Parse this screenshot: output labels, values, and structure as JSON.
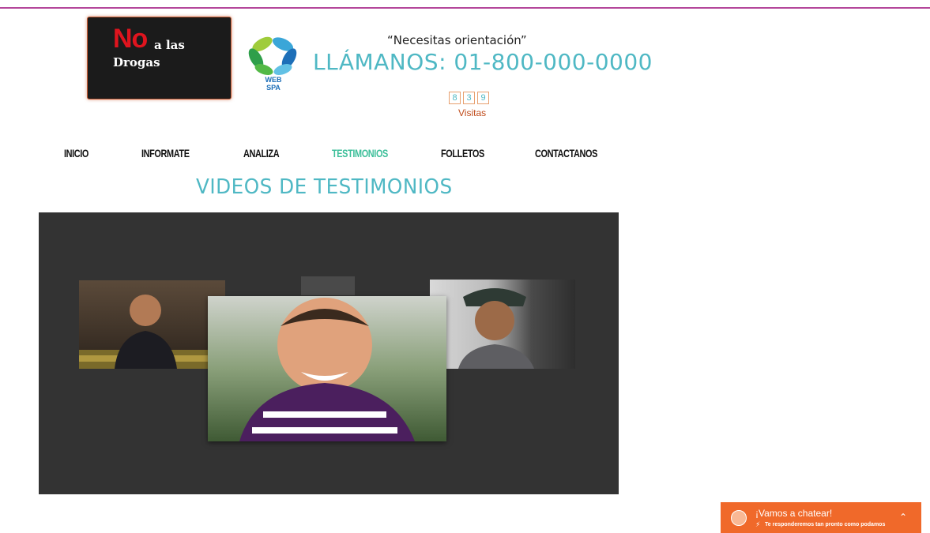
{
  "logo": {
    "no": "No",
    "a_las": "a las",
    "drogas": "Drogas"
  },
  "spa_logo": {
    "line1": "WEB",
    "line2": "SPA"
  },
  "header": {
    "tagline": "“Necesitas orientación”",
    "phone": "LLÁMANOS: 01-800-000-0000"
  },
  "visits": {
    "digits": [
      "8",
      "3",
      "9"
    ],
    "label": "Visitas"
  },
  "nav": {
    "items": [
      "INICIO",
      "INFORMATE",
      "ANALIZA",
      "TESTIMONIOS",
      "FOLLETOS",
      "CONTACTANOS"
    ],
    "active": "TESTIMONIOS"
  },
  "section": {
    "title": "VIDEOS DE TESTIMONIOS"
  },
  "chat": {
    "title": "¡Vamos a chatear!",
    "subtitle": "Te responderemos tan pronto como podamos"
  },
  "colors": {
    "accent": "#4fb8c4",
    "nav_active": "#3dbf9a",
    "chat": "#f0692a",
    "topline": "#b4479b"
  },
  "icons": [
    "bolt-icon",
    "chevron-up-icon",
    "smiley-icon"
  ]
}
